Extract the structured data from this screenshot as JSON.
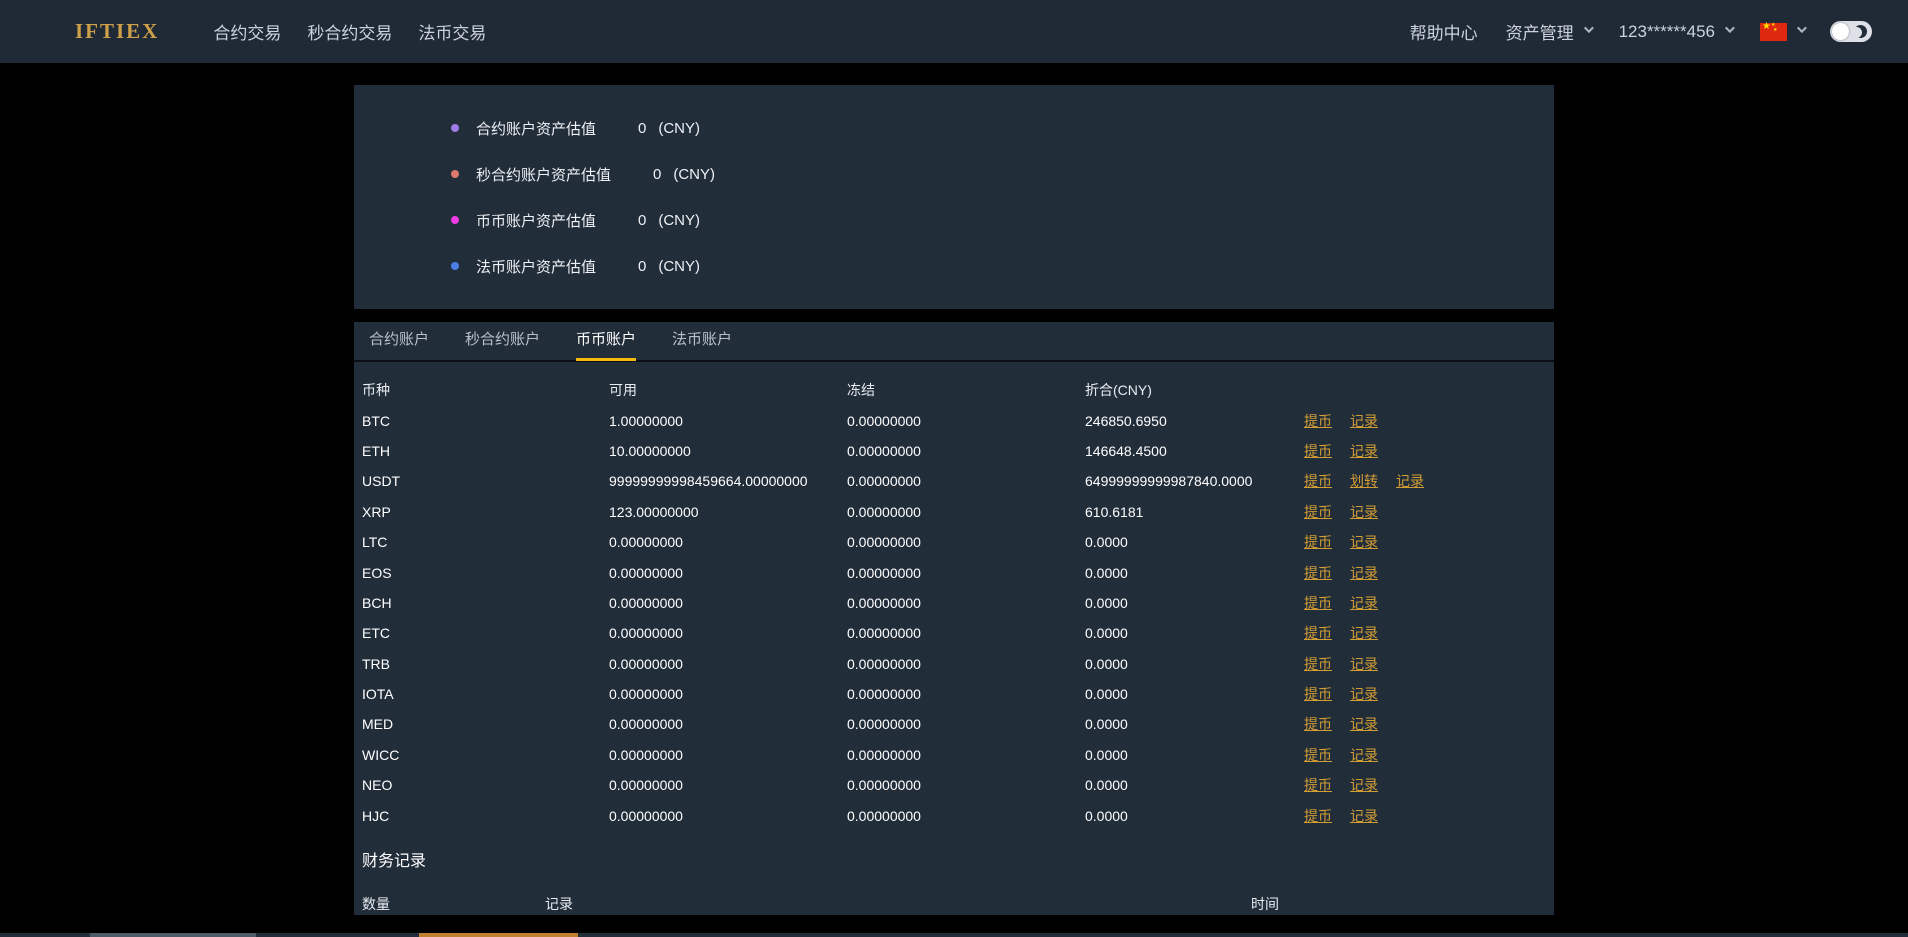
{
  "navbar": {
    "logo_text": "IFTIEX",
    "menu": [
      "合约交易",
      "秒合约交易",
      "法币交易"
    ],
    "help": "帮助中心",
    "assets": "资产管理",
    "account": "123******456"
  },
  "colors": {
    "accent_gold": "#f0b90b",
    "link_gold": "#d29d33",
    "navbar_bg": "#1f2a36",
    "panel_bg": "#222d3a"
  },
  "summary": {
    "items": [
      {
        "label": "合约账户资产估值",
        "value": "0",
        "unit": "(CNY)",
        "color": "#9f7ce8"
      },
      {
        "label": "秒合约账户资产估值",
        "value": "0",
        "unit": "(CNY)",
        "color": "#e0796d"
      },
      {
        "label": "币币账户资产估值",
        "value": "0",
        "unit": "(CNY)",
        "color": "#ee3ce2"
      },
      {
        "label": "法币账户资产估值",
        "value": "0",
        "unit": "(CNY)",
        "color": "#4a80e8"
      }
    ]
  },
  "tabs": [
    {
      "label": "合约账户",
      "active": false
    },
    {
      "label": "秒合约账户",
      "active": false
    },
    {
      "label": "币币账户",
      "active": true
    },
    {
      "label": "法币账户",
      "active": false
    }
  ],
  "wallet_table": {
    "headers": [
      "币种",
      "可用",
      "冻结",
      "折合(CNY)"
    ],
    "action_labels": {
      "withdraw": "提币",
      "transfer": "划转",
      "record": "记录"
    },
    "rows": [
      {
        "coin": "BTC",
        "available": "1.00000000",
        "frozen": "0.00000000",
        "converted": "246850.6950",
        "actions": [
          "withdraw",
          "record"
        ]
      },
      {
        "coin": "ETH",
        "available": "10.00000000",
        "frozen": "0.00000000",
        "converted": "146648.4500",
        "actions": [
          "withdraw",
          "record"
        ]
      },
      {
        "coin": "USDT",
        "available": "99999999998459664.00000000",
        "frozen": "0.00000000",
        "converted": "64999999999987840.0000",
        "actions": [
          "withdraw",
          "transfer",
          "record"
        ]
      },
      {
        "coin": "XRP",
        "available": "123.00000000",
        "frozen": "0.00000000",
        "converted": "610.6181",
        "actions": [
          "withdraw",
          "record"
        ]
      },
      {
        "coin": "LTC",
        "available": "0.00000000",
        "frozen": "0.00000000",
        "converted": "0.0000",
        "actions": [
          "withdraw",
          "record"
        ]
      },
      {
        "coin": "EOS",
        "available": "0.00000000",
        "frozen": "0.00000000",
        "converted": "0.0000",
        "actions": [
          "withdraw",
          "record"
        ]
      },
      {
        "coin": "BCH",
        "available": "0.00000000",
        "frozen": "0.00000000",
        "converted": "0.0000",
        "actions": [
          "withdraw",
          "record"
        ]
      },
      {
        "coin": "ETC",
        "available": "0.00000000",
        "frozen": "0.00000000",
        "converted": "0.0000",
        "actions": [
          "withdraw",
          "record"
        ]
      },
      {
        "coin": "TRB",
        "available": "0.00000000",
        "frozen": "0.00000000",
        "converted": "0.0000",
        "actions": [
          "withdraw",
          "record"
        ]
      },
      {
        "coin": "IOTA",
        "available": "0.00000000",
        "frozen": "0.00000000",
        "converted": "0.0000",
        "actions": [
          "withdraw",
          "record"
        ]
      },
      {
        "coin": "MED",
        "available": "0.00000000",
        "frozen": "0.00000000",
        "converted": "0.0000",
        "actions": [
          "withdraw",
          "record"
        ]
      },
      {
        "coin": "WICC",
        "available": "0.00000000",
        "frozen": "0.00000000",
        "converted": "0.0000",
        "actions": [
          "withdraw",
          "record"
        ]
      },
      {
        "coin": "NEO",
        "available": "0.00000000",
        "frozen": "0.00000000",
        "converted": "0.0000",
        "actions": [
          "withdraw",
          "record"
        ]
      },
      {
        "coin": "HJC",
        "available": "0.00000000",
        "frozen": "0.00000000",
        "converted": "0.0000",
        "actions": [
          "withdraw",
          "record"
        ]
      }
    ]
  },
  "records": {
    "title": "财务记录",
    "headers": [
      "数量",
      "记录",
      "时间"
    ]
  }
}
